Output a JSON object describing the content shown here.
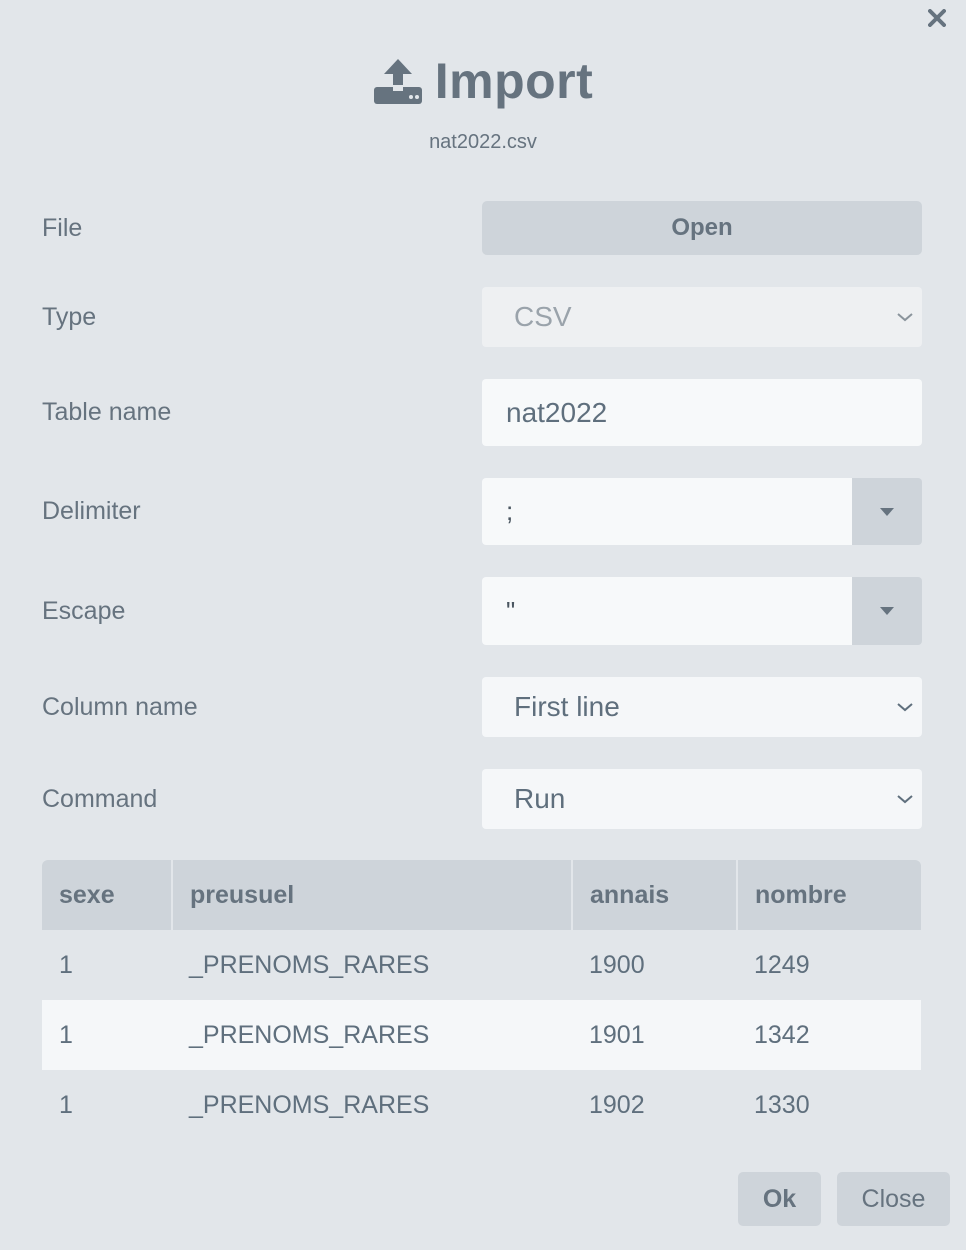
{
  "dialog": {
    "title": "Import",
    "filename": "nat2022.csv"
  },
  "form": {
    "file": {
      "label": "File",
      "button": "Open"
    },
    "type": {
      "label": "Type",
      "value": "CSV"
    },
    "table_name": {
      "label": "Table name",
      "value": "nat2022"
    },
    "delimiter": {
      "label": "Delimiter",
      "value": ";"
    },
    "escape": {
      "label": "Escape",
      "value": "\""
    },
    "column_name": {
      "label": "Column name",
      "value": "First line"
    },
    "command": {
      "label": "Command",
      "value": "Run"
    }
  },
  "preview": {
    "columns": [
      "sexe",
      "preusuel",
      "annais",
      "nombre"
    ],
    "rows": [
      [
        "1",
        "_PRENOMS_RARES",
        "1900",
        "1249"
      ],
      [
        "1",
        "_PRENOMS_RARES",
        "1901",
        "1342"
      ],
      [
        "1",
        "_PRENOMS_RARES",
        "1902",
        "1330"
      ]
    ]
  },
  "footer": {
    "ok": "Ok",
    "close": "Close"
  },
  "icons": {
    "upload": "upload-icon",
    "close": "close-icon",
    "chevron": "chevron-down-icon",
    "caret": "caret-down-icon"
  }
}
